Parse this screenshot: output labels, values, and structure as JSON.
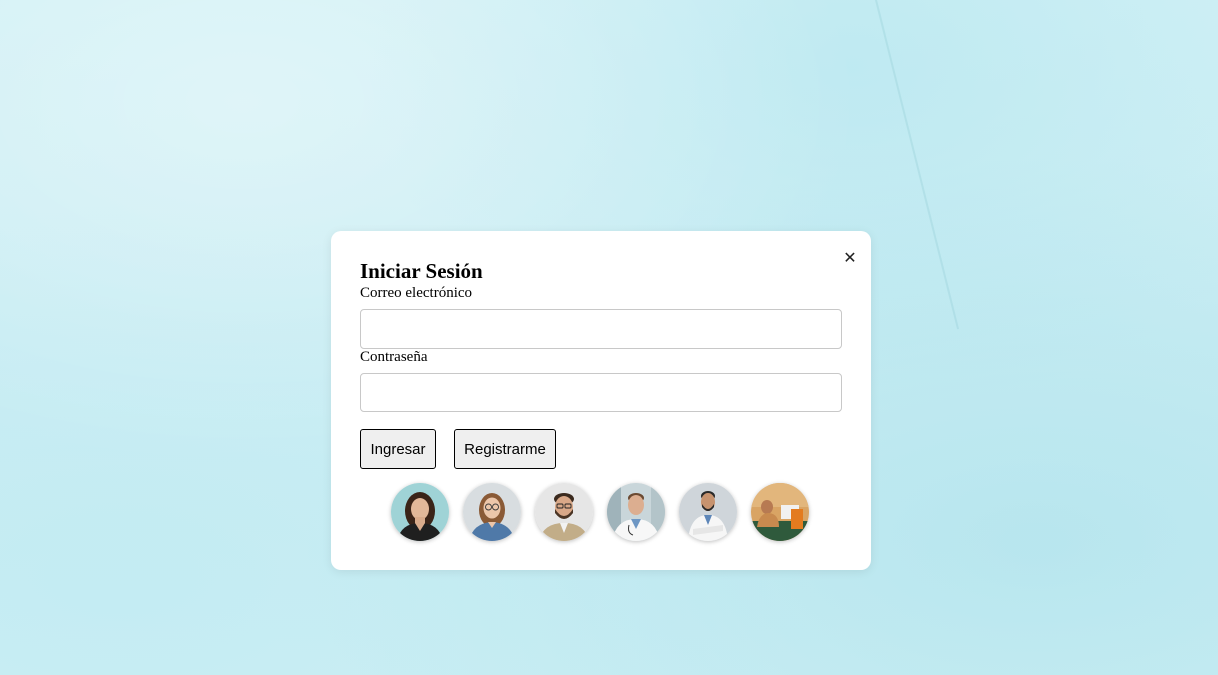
{
  "modal": {
    "title": "Iniciar Sesión",
    "close_symbol": "✕",
    "email": {
      "label": "Correo electrónico",
      "value": "",
      "placeholder": ""
    },
    "password": {
      "label": "Contraseña",
      "value": "",
      "placeholder": ""
    },
    "buttons": {
      "login_label": "Ingresar",
      "register_label": "Registrarme"
    },
    "avatars": [
      {
        "icon": "woman-portrait-avatar"
      },
      {
        "icon": "woman-glasses-portrait-avatar"
      },
      {
        "icon": "man-bearded-portrait-avatar"
      },
      {
        "icon": "doctor-portrait-avatar"
      },
      {
        "icon": "doctor-arms-crossed-avatar"
      },
      {
        "icon": "person-workspace-avatar"
      }
    ]
  },
  "colors": {
    "background": "#cdeff4",
    "modal": "#ffffff",
    "button_bg": "#efefef",
    "input_border": "#c8c8c8"
  }
}
